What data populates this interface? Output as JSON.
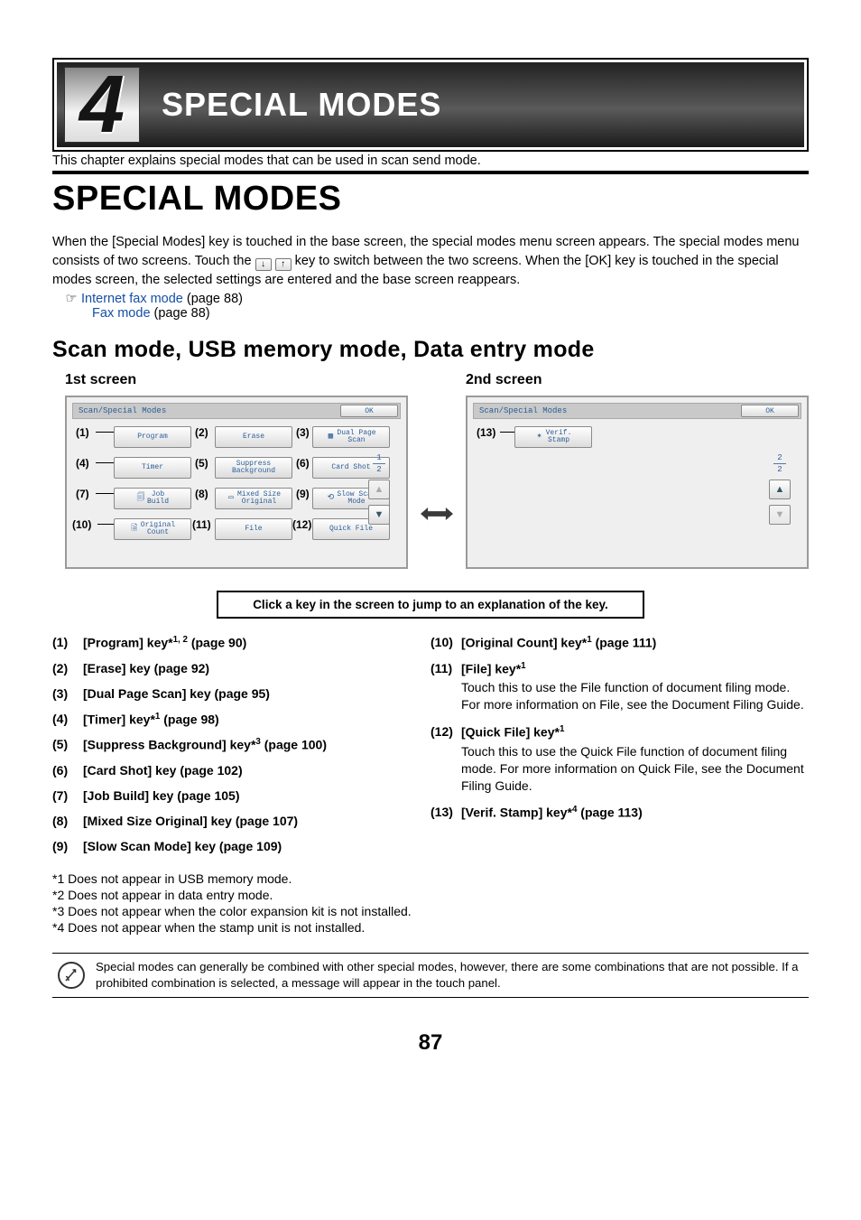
{
  "chapter": {
    "number": "4",
    "title": "SPECIAL MODES"
  },
  "intro": "This chapter explains special modes that can be used in scan send mode.",
  "section_title": "SPECIAL MODES",
  "body1": "When the [Special Modes] key is touched in the base screen, the special modes menu screen appears. The special modes menu consists of two screens. Touch the ",
  "body2": " key to switch between the two screens. When the [OK] key is touched in the special modes screen, the selected settings are entered and the base screen reappears.",
  "xref1_text": "Internet fax mode",
  "xref1_page": " (page 88)",
  "xref2_text": "Fax mode",
  "xref2_page": " (page 88)",
  "subheading": "Scan mode, USB memory mode, Data entry mode",
  "screen1_head": "1st screen",
  "screen2_head": "2nd screen",
  "panel_title": "Scan/Special Modes",
  "ok_label": "OK",
  "keys": {
    "k1": "Program",
    "k2": "Erase",
    "k3": "Dual Page\nScan",
    "k4": "Timer",
    "k5": "Suppress\nBackground",
    "k6": "Card Shot",
    "k7": "Job\nBuild",
    "k8": "Mixed Size\nOriginal",
    "k9": "Slow Scan\nMode",
    "k10": "Original\nCount",
    "k11": "File",
    "k12": "Quick File",
    "k13": "Verif.\nStamp"
  },
  "markers": {
    "m1": "(1)",
    "m2": "(2)",
    "m3": "(3)",
    "m4": "(4)",
    "m5": "(5)",
    "m6": "(6)",
    "m7": "(7)",
    "m8": "(8)",
    "m9": "(9)",
    "m10": "(10)",
    "m11": "(11)",
    "m12": "(12)",
    "m13": "(13)"
  },
  "page_indicator": {
    "s1_top": "1",
    "s1_bot": "2",
    "s2_top": "2",
    "s2_bot": "2"
  },
  "hint": "Click a key in the screen to jump to an explanation of the key.",
  "left_list": [
    {
      "n": "(1)",
      "t": "[Program] key*",
      "sup": "1, 2",
      "after": " (page 90)"
    },
    {
      "n": "(2)",
      "t": "[Erase] key (page 92)"
    },
    {
      "n": "(3)",
      "t": "[Dual Page Scan] key (page 95)"
    },
    {
      "n": "(4)",
      "t": "[Timer] key*",
      "sup": "1",
      "after": " (page 98)"
    },
    {
      "n": "(5)",
      "t": "[Suppress Background] key*",
      "sup": "3",
      "after": " (page 100)"
    },
    {
      "n": "(6)",
      "t": "[Card Shot] key (page 102)"
    },
    {
      "n": "(7)",
      "t": "[Job Build] key (page 105)"
    },
    {
      "n": "(8)",
      "t": "[Mixed Size Original] key (page 107)"
    },
    {
      "n": "(9)",
      "t": "[Slow Scan Mode] key (page 109)"
    }
  ],
  "right_list": [
    {
      "n": "(10)",
      "t": "[Original Count] key*",
      "sup": "1",
      "after": " (page 111)"
    },
    {
      "n": "(11)",
      "t": "[File] key*",
      "sup": "1",
      "desc": "Touch this to use the File function of document filing mode. For more information on File, see the Document Filing Guide."
    },
    {
      "n": "(12)",
      "t": "[Quick File] key*",
      "sup": "1",
      "desc": "Touch this to use the Quick File function of document filing mode. For more information on Quick File, see the Document Filing Guide."
    },
    {
      "n": "(13)",
      "t": "[Verif. Stamp] key*",
      "sup": "4",
      "after": " (page 113)"
    }
  ],
  "footnotes": [
    "*1 Does not appear in USB memory mode.",
    "*2 Does not appear in data entry mode.",
    "*3 Does not appear when the color expansion kit is not installed.",
    "*4 Does not appear when the stamp unit is not installed."
  ],
  "note": "Special modes can generally be combined with other special modes, however, there are some combinations that are not possible. If a prohibited combination is selected, a message will appear in the touch panel.",
  "page_number": "87"
}
